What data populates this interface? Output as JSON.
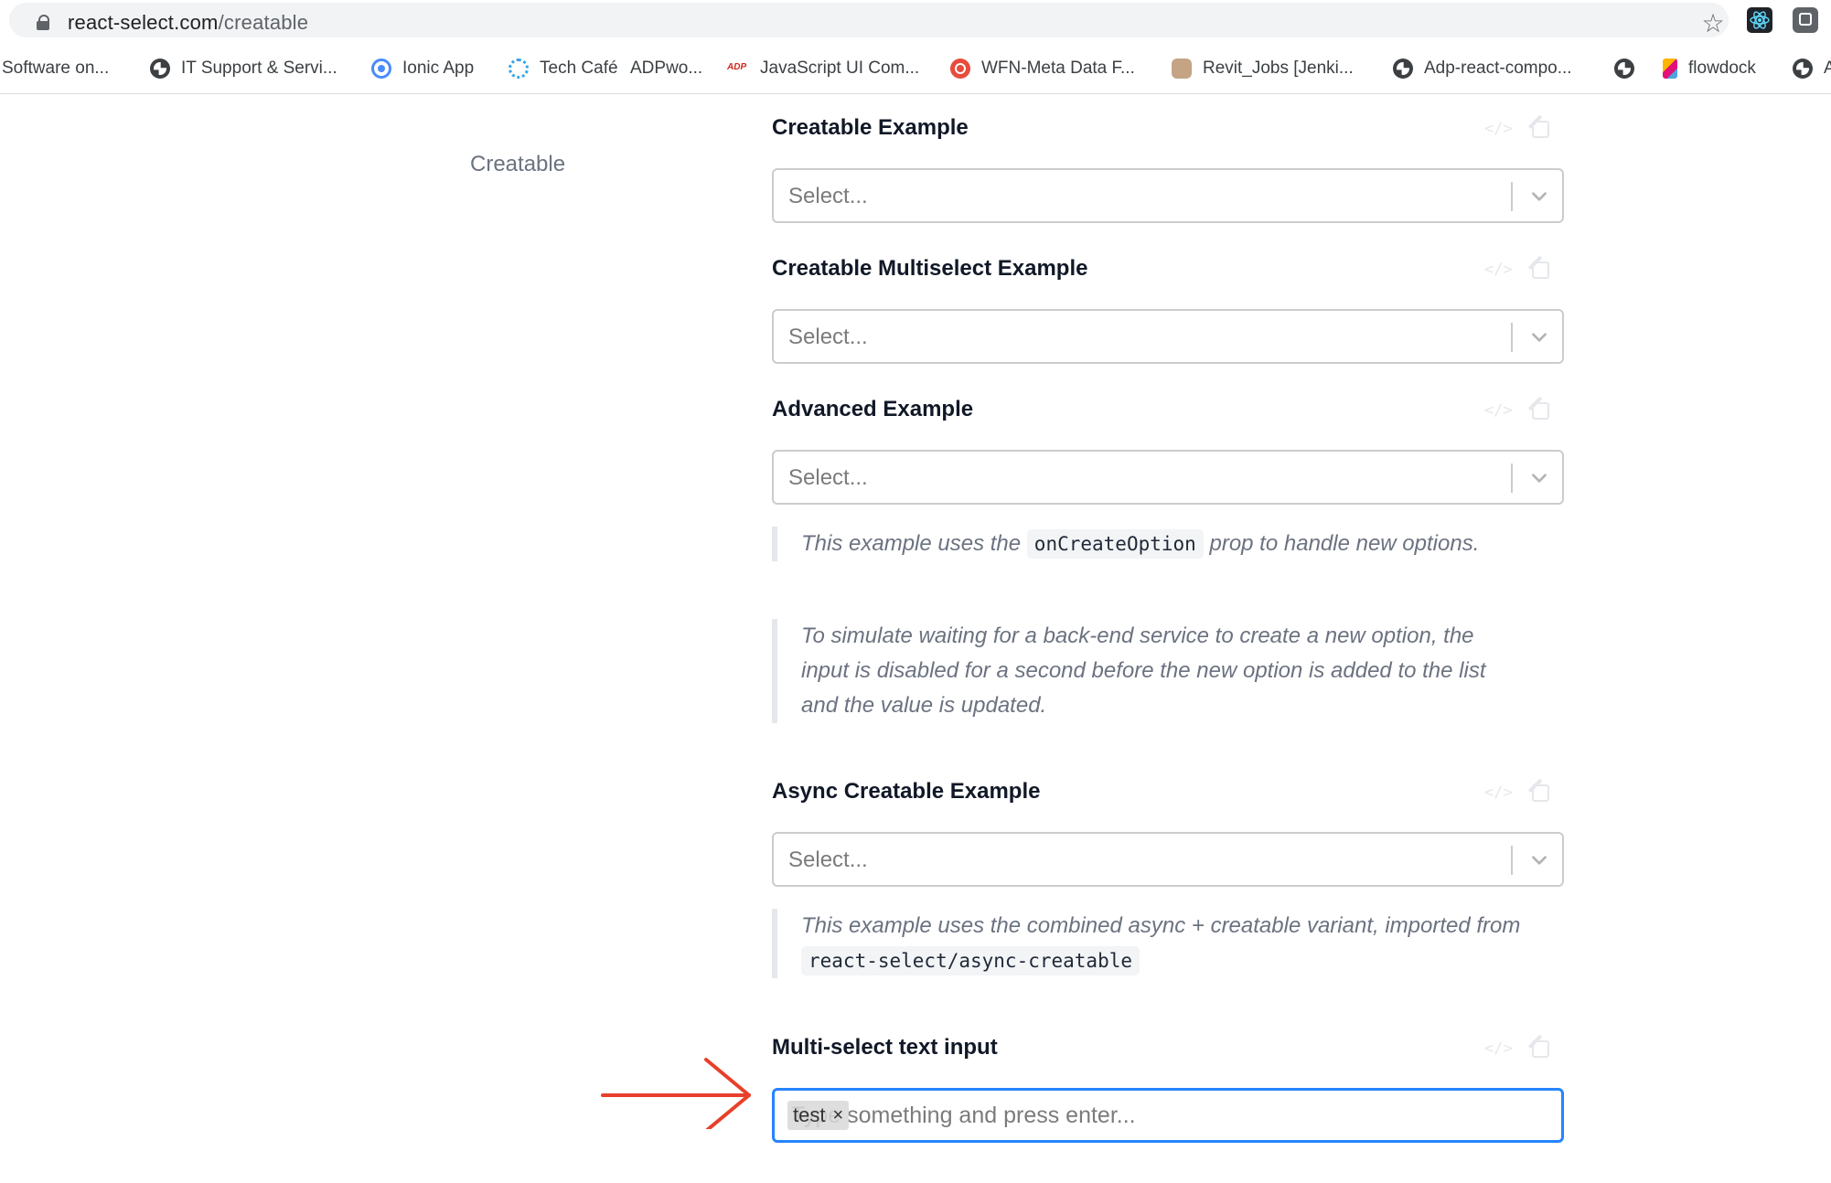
{
  "browser": {
    "url_host": "react-select.com",
    "url_path": "/creatable"
  },
  "bookmarks": [
    {
      "label": "Software on...",
      "icon": "none"
    },
    {
      "label": "IT Support & Servi...",
      "icon": "globe-icon"
    },
    {
      "label": "Ionic App",
      "icon": "ionic-icon"
    },
    {
      "label": "Tech Café",
      "icon": "tech-cafe-icon"
    },
    {
      "label": "ADPwo...",
      "icon": "none"
    },
    {
      "label": "JavaScript UI Com...",
      "icon": "adp-icon"
    },
    {
      "label": "WFN-Meta Data F...",
      "icon": "wfn-icon"
    },
    {
      "label": "Revit_Jobs [Jenki...",
      "icon": "jenkins-icon"
    },
    {
      "label": "Adp-react-compo...",
      "icon": "globe-icon"
    },
    {
      "label": "",
      "icon": "globe-icon"
    },
    {
      "label": "flowdock",
      "icon": "flowdock-icon"
    },
    {
      "label": "A",
      "icon": "globe-icon"
    }
  ],
  "page": {
    "side_label": "Creatable",
    "sections": [
      {
        "title": "Creatable Example",
        "placeholder": "Select..."
      },
      {
        "title": "Creatable Multiselect Example",
        "placeholder": "Select..."
      },
      {
        "title": "Advanced Example",
        "placeholder": "Select..."
      },
      {
        "title": "Async Creatable Example",
        "placeholder": "Select..."
      },
      {
        "title": "Multi-select text input",
        "placeholder": "Type something and press enter..."
      }
    ],
    "notes": {
      "advanced_1_pre": "This example uses the ",
      "advanced_1_code": "onCreateOption",
      "advanced_1_post": " prop to handle new options.",
      "advanced_2": "To simulate waiting for a back-end service to create a new option, the input is disabled for a second before the new option is added to the list and the value is updated.",
      "async_pre": "This example uses the combined async + creatable variant, imported from ",
      "async_code": "react-select/async-creatable"
    },
    "multi_input_chip": "test",
    "multi_input_chip_remove": "×"
  },
  "colors": {
    "focus_border": "#2684ff",
    "arrow": "#e8402a"
  }
}
